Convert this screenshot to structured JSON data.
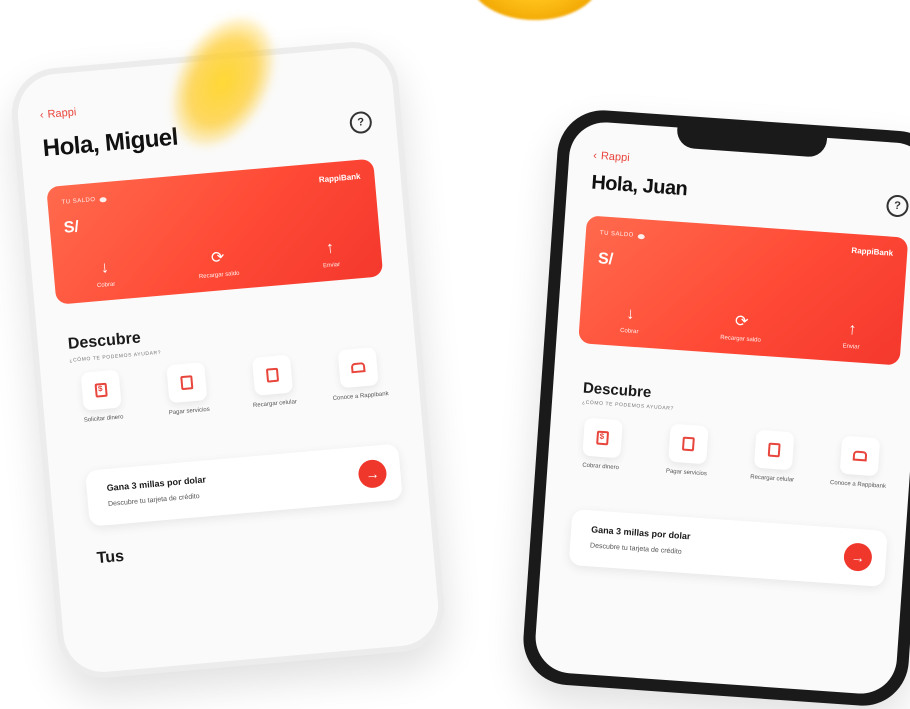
{
  "colors": {
    "accent": "#f0372c",
    "card_start": "#ff6a4d",
    "card_end": "#f4382d"
  },
  "phone_left": {
    "back_label": "Rappi",
    "greeting": "Hola, Miguel",
    "card": {
      "balance_label": "TU SALDO",
      "brand": "RappiBank",
      "currency": "S/",
      "actions": [
        {
          "icon": "arrow-down-icon",
          "label": "Cobrar"
        },
        {
          "icon": "recharge-icon",
          "label": "Recargar saldo"
        },
        {
          "icon": "arrow-up-icon",
          "label": "Enviar"
        }
      ]
    },
    "discover_title": "Descubre",
    "discover_subtitle": "¿CÓMO TE PODEMOS AYUDAR?",
    "services": [
      {
        "icon": "money-icon",
        "label": "Solicitar dinero"
      },
      {
        "icon": "bill-icon",
        "label": "Pagar servicios"
      },
      {
        "icon": "phone-icon",
        "label": "Recargar celular"
      },
      {
        "icon": "bank-icon",
        "label": "Conoce a Rappibank"
      }
    ],
    "promo": {
      "title": "Gana 3 millas por dolar",
      "subtitle": "Descubre tu tarjeta de crédito"
    },
    "bottom_title": "Tus"
  },
  "phone_right": {
    "back_label": "Rappi",
    "greeting": "Hola, Juan",
    "card": {
      "balance_label": "TU SALDO",
      "brand": "RappiBank",
      "currency": "S/",
      "actions": [
        {
          "icon": "arrow-down-icon",
          "label": "Cobrar"
        },
        {
          "icon": "recharge-icon",
          "label": "Recargar saldo"
        },
        {
          "icon": "arrow-up-icon",
          "label": "Enviar"
        }
      ]
    },
    "discover_title": "Descubre",
    "discover_subtitle": "¿CÓMO TE PODEMOS AYUDAR?",
    "services": [
      {
        "icon": "money-icon",
        "label": "Cobrar dinero"
      },
      {
        "icon": "bill-icon",
        "label": "Pagar servicios"
      },
      {
        "icon": "phone-icon",
        "label": "Recargar celular"
      },
      {
        "icon": "bank-icon",
        "label": "Conoce a Rappibank"
      }
    ],
    "promo": {
      "title": "Gana 3 millas por dolar",
      "subtitle": "Descubre tu tarjeta de crédito"
    }
  }
}
